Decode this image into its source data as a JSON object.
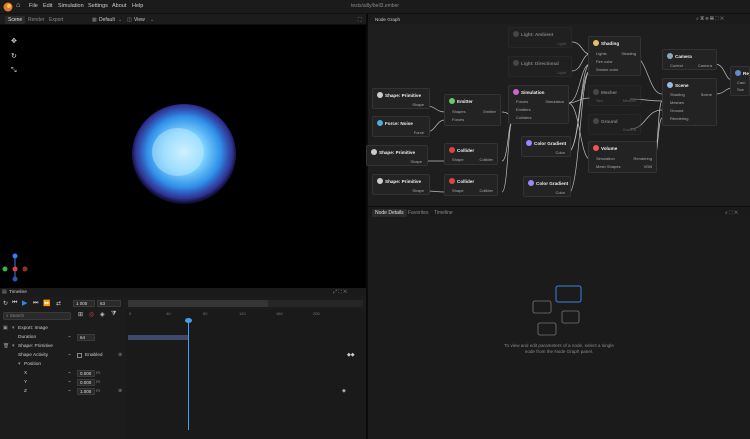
{
  "menu": {
    "items": [
      "File",
      "Edit",
      "Simulation",
      "Settings",
      "About",
      "Help"
    ],
    "title": "tests/ailly/bell3.ember"
  },
  "viewport": {
    "tabs": [
      "Scene",
      "Render",
      "Export"
    ],
    "layout_label": "Default",
    "view_label": "View"
  },
  "node_graph": {
    "panel_title": "Node Graph",
    "nodes": {
      "light_ambient": {
        "title": "Light: Ambient",
        "out": "Light"
      },
      "light_directional": {
        "title": "Light: Directional",
        "out": "Light"
      },
      "shading": {
        "title": "Shading",
        "ports": [
          "Lights",
          "Fire color",
          "Smoke color"
        ],
        "out": "Shading"
      },
      "camera": {
        "title": "Camera",
        "in": "Control",
        "out": "Camera"
      },
      "scene": {
        "title": "Scene",
        "ports": [
          "Shading",
          "Meshes",
          "Ground",
          "Rendering"
        ],
        "out": "Scene"
      },
      "render_partial": {
        "title": "Re",
        "ports": [
          "Cam",
          "Sce"
        ]
      },
      "shape_primitive_1": {
        "title": "Shape: Primitive",
        "out": "Shape"
      },
      "force_noise": {
        "title": "Force: Noise",
        "out": "Force"
      },
      "emitter": {
        "title": "Emitter",
        "ports": [
          "Shapes",
          "Forces"
        ],
        "out": "Emitter"
      },
      "simulation": {
        "title": "Simulation",
        "ports": [
          "Forces",
          "Emitters",
          "Colliders"
        ],
        "out": "Simulation"
      },
      "mesher": {
        "title": "Mesher",
        "ports": [
          "Sim"
        ],
        "out": "Mesher"
      },
      "ground": {
        "title": "Ground",
        "out": "Ground"
      },
      "shape_primitive_2": {
        "title": "Shape: Primitive",
        "out": "Shape"
      },
      "collider_1": {
        "title": "Collider",
        "ports": [
          "Shape"
        ],
        "out": "Collider"
      },
      "color_gradient_1": {
        "title": "Color Gradient",
        "out": "Color"
      },
      "volume": {
        "title": "Volume",
        "ports": [
          "Simulation",
          "Mesh Shapes"
        ],
        "outs": [
          "Rendering",
          "VDB"
        ]
      },
      "shape_primitive_3": {
        "title": "Shape: Primitive",
        "out": "Shape"
      },
      "collider_2": {
        "title": "Collider",
        "ports": [
          "Shape"
        ],
        "out": "Collider"
      },
      "color_gradient_2": {
        "title": "Color Gradient",
        "out": "Color"
      }
    }
  },
  "properties": {
    "tabs": [
      "Node Details",
      "Favorites",
      "Timeline"
    ],
    "empty_message_line1": "To view and edit parameters of a node, select a single",
    "empty_message_line2": "node from the Node Graph panel."
  },
  "timeline": {
    "title": "Timeline",
    "frame_start": "1 000",
    "frame_current": "63",
    "search_placeholder": "Search",
    "ticks": [
      "0",
      "40",
      "80",
      "120",
      "160",
      "200"
    ],
    "rows": {
      "export_image": "Export: Image",
      "duration_label": "Duration",
      "duration_value": "64",
      "shape_primitive": "Shape: Primitive",
      "shape_activity": "Shape Activity",
      "enabled_label": "Enabled",
      "position": "Position",
      "x_label": "X",
      "x_value": "0.000",
      "y_label": "Y",
      "y_value": "0.000",
      "z_label": "Z",
      "z_value": "1.000",
      "unit": "m"
    }
  },
  "colors": {
    "accent": "#3b82e6",
    "playhead": "#4a9ce8",
    "fire": "#6fc8ff"
  }
}
